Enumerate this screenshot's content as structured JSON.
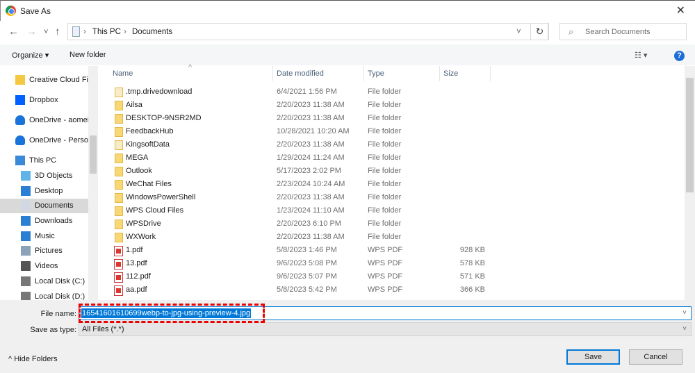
{
  "window": {
    "title": "Save As",
    "close": "✕"
  },
  "nav": {
    "back": "←",
    "forward": "→",
    "recent": "˅",
    "up": "↑"
  },
  "address": {
    "crumbs": [
      "This PC",
      "Documents"
    ],
    "sep": "›",
    "dropdown": "˅",
    "refresh": "↻"
  },
  "search": {
    "placeholder": "Search Documents",
    "icon": "⌕"
  },
  "toolbar": {
    "organize": "Organize ▾",
    "new_folder": "New folder",
    "view": "☷ ▾",
    "help": "?"
  },
  "sidebar": {
    "items": [
      {
        "label": "Creative Cloud Files",
        "icon": "creative-cloud-icon"
      },
      {
        "label": "Dropbox",
        "icon": "dropbox-icon"
      },
      {
        "label": "OneDrive - aomei",
        "icon": "onedrive-icon"
      },
      {
        "label": "OneDrive - Personal",
        "icon": "onedrive-icon"
      },
      {
        "label": "This PC",
        "icon": "computer-icon"
      },
      {
        "label": "3D Objects",
        "icon": "3d-objects-icon"
      },
      {
        "label": "Desktop",
        "icon": "desktop-icon"
      },
      {
        "label": "Documents",
        "icon": "documents-icon",
        "selected": true
      },
      {
        "label": "Downloads",
        "icon": "downloads-icon"
      },
      {
        "label": "Music",
        "icon": "music-icon"
      },
      {
        "label": "Pictures",
        "icon": "pictures-icon"
      },
      {
        "label": "Videos",
        "icon": "videos-icon"
      },
      {
        "label": "Local Disk (C:)",
        "icon": "disk-icon"
      },
      {
        "label": "Local Disk (D:)",
        "icon": "disk-icon"
      }
    ]
  },
  "columns": {
    "name": "Name",
    "date": "Date modified",
    "type": "Type",
    "size": "Size"
  },
  "files": [
    {
      "name": ".tmp.drivedownload",
      "date": "6/4/2021 1:56 PM",
      "type": "File folder",
      "size": "",
      "kind": "folder-light"
    },
    {
      "name": "Ailsa",
      "date": "2/20/2023 11:38 AM",
      "type": "File folder",
      "size": "",
      "kind": "folder"
    },
    {
      "name": "DESKTOP-9NSR2MD",
      "date": "2/20/2023 11:38 AM",
      "type": "File folder",
      "size": "",
      "kind": "folder"
    },
    {
      "name": "FeedbackHub",
      "date": "10/28/2021 10:20 AM",
      "type": "File folder",
      "size": "",
      "kind": "folder"
    },
    {
      "name": "KingsoftData",
      "date": "2/20/2023 11:38 AM",
      "type": "File folder",
      "size": "",
      "kind": "folder-light"
    },
    {
      "name": "MEGA",
      "date": "1/29/2024 11:24 AM",
      "type": "File folder",
      "size": "",
      "kind": "folder"
    },
    {
      "name": "Outlook",
      "date": "5/17/2023 2:02 PM",
      "type": "File folder",
      "size": "",
      "kind": "folder"
    },
    {
      "name": "WeChat Files",
      "date": "2/23/2024 10:24 AM",
      "type": "File folder",
      "size": "",
      "kind": "folder"
    },
    {
      "name": "WindowsPowerShell",
      "date": "2/20/2023 11:38 AM",
      "type": "File folder",
      "size": "",
      "kind": "folder"
    },
    {
      "name": "WPS Cloud Files",
      "date": "1/23/2024 11:10 AM",
      "type": "File folder",
      "size": "",
      "kind": "folder"
    },
    {
      "name": "WPSDrive",
      "date": "2/20/2023 6:10 PM",
      "type": "File folder",
      "size": "",
      "kind": "folder"
    },
    {
      "name": "WXWork",
      "date": "2/20/2023 11:38 AM",
      "type": "File folder",
      "size": "",
      "kind": "folder"
    },
    {
      "name": "1.pdf",
      "date": "5/8/2023 1:46 PM",
      "type": "WPS PDF",
      "size": "928 KB",
      "kind": "pdf"
    },
    {
      "name": "13.pdf",
      "date": "9/6/2023 5:08 PM",
      "type": "WPS PDF",
      "size": "578 KB",
      "kind": "pdf"
    },
    {
      "name": "112.pdf",
      "date": "9/6/2023 5:07 PM",
      "type": "WPS PDF",
      "size": "571 KB",
      "kind": "pdf"
    },
    {
      "name": "aa.pdf",
      "date": "5/8/2023 5:42 PM",
      "type": "WPS PDF",
      "size": "366 KB",
      "kind": "pdf"
    }
  ],
  "form": {
    "file_name_label": "File name:",
    "file_name_value": "16541601610699webp-to-jpg-using-preview-4.jpg",
    "type_label": "Save as type:",
    "type_value": "All Files (*.*)",
    "dropdown": "˅"
  },
  "footer": {
    "hide_folders": "^  Hide Folders",
    "save": "Save",
    "cancel": "Cancel"
  },
  "colors": {
    "accent": "#0078d7",
    "highlight": "#e00000"
  }
}
